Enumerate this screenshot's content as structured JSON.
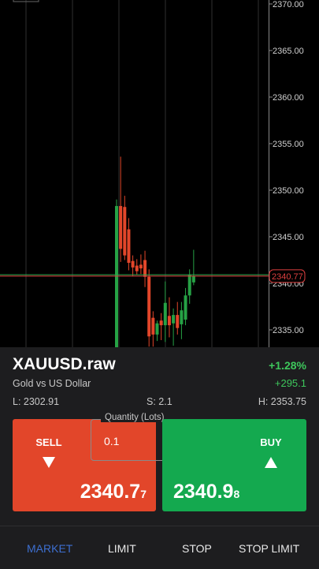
{
  "chart": {
    "y_ticks": [
      "2370.00",
      "2365.00",
      "2360.00",
      "2355.00",
      "2350.00",
      "2345.00",
      "2340.00",
      "2335.00"
    ],
    "current_price_label": "2340.77",
    "colors": {
      "up": "#26a245",
      "down": "#e2462a",
      "grid": "#333333",
      "axis": "#888888",
      "price_line": "#e04040",
      "bid_line": "#2ea84e"
    }
  },
  "chart_data": {
    "type": "candlestick",
    "y_axis_ticks": [
      2370,
      2365,
      2360,
      2355,
      2350,
      2345,
      2340,
      2335
    ],
    "current_price": 2340.77,
    "candles": [
      {
        "open": 2328,
        "close": 2348.3,
        "high": 2349,
        "low": 2328,
        "dir": "up"
      },
      {
        "open": 2348.3,
        "close": 2343.7,
        "high": 2353.6,
        "low": 2342.3,
        "dir": "down"
      },
      {
        "open": 2348.2,
        "close": 2343.0,
        "high": 2349.4,
        "low": 2342.5,
        "dir": "down"
      },
      {
        "open": 2345.8,
        "close": 2342.2,
        "high": 2347.0,
        "low": 2341.4,
        "dir": "down"
      },
      {
        "open": 2342.4,
        "close": 2341.7,
        "high": 2343.0,
        "low": 2340.8,
        "dir": "down"
      },
      {
        "open": 2341.9,
        "close": 2341.3,
        "high": 2342.6,
        "low": 2340.9,
        "dir": "down"
      },
      {
        "open": 2342.0,
        "close": 2341.6,
        "high": 2343.1,
        "low": 2341.0,
        "dir": "down"
      },
      {
        "open": 2342.5,
        "close": 2340.7,
        "high": 2343.5,
        "low": 2339.6,
        "dir": "down"
      },
      {
        "open": 2340.7,
        "close": 2334.3,
        "high": 2341.5,
        "low": 2333.2,
        "dir": "down"
      },
      {
        "open": 2336.3,
        "close": 2334.5,
        "high": 2337.0,
        "low": 2333.2,
        "dir": "down"
      },
      {
        "open": 2334.5,
        "close": 2335.7,
        "high": 2336.0,
        "low": 2333.8,
        "dir": "up"
      },
      {
        "open": 2336.0,
        "close": 2335.5,
        "high": 2336.8,
        "low": 2333.9,
        "dir": "down"
      },
      {
        "open": 2335.5,
        "close": 2337.9,
        "high": 2340.2,
        "low": 2333.7,
        "dir": "up"
      },
      {
        "open": 2336.5,
        "close": 2335.5,
        "high": 2338.5,
        "low": 2334.2,
        "dir": "down"
      },
      {
        "open": 2335.7,
        "close": 2336.6,
        "high": 2337.3,
        "low": 2333.3,
        "dir": "up"
      },
      {
        "open": 2336.6,
        "close": 2335.2,
        "high": 2338.0,
        "low": 2334.5,
        "dir": "down"
      },
      {
        "open": 2335.6,
        "close": 2337.1,
        "high": 2338.0,
        "low": 2334.0,
        "dir": "up"
      },
      {
        "open": 2336.1,
        "close": 2338.7,
        "high": 2339.5,
        "low": 2335.5,
        "dir": "up"
      },
      {
        "open": 2338.7,
        "close": 2340.9,
        "high": 2341.5,
        "low": 2337.8,
        "dir": "up"
      },
      {
        "open": 2340.1,
        "close": 2340.8,
        "high": 2343.6,
        "low": 2339.8,
        "dir": "up"
      }
    ]
  },
  "instrument": {
    "symbol": "XAUUSD.raw",
    "description": "Gold vs US Dollar",
    "change_percent": "+1.28%",
    "change_abs": "+295.1",
    "low": "L: 2302.91",
    "spread": "S: 2.1",
    "high": "H: 2353.75"
  },
  "sell": {
    "label": "SELL",
    "price_main": "2340.7",
    "price_small": "7"
  },
  "buy": {
    "label": "BUY",
    "price_main": "2340.9",
    "price_small": "8"
  },
  "quantity": {
    "legend": "Quantity (Lots)",
    "value": "0.1"
  },
  "tabs": [
    {
      "label": "MARKET",
      "active": true
    },
    {
      "label": "LIMIT",
      "active": false
    },
    {
      "label": "STOP",
      "active": false
    },
    {
      "label": "STOP LIMIT",
      "active": false
    }
  ]
}
